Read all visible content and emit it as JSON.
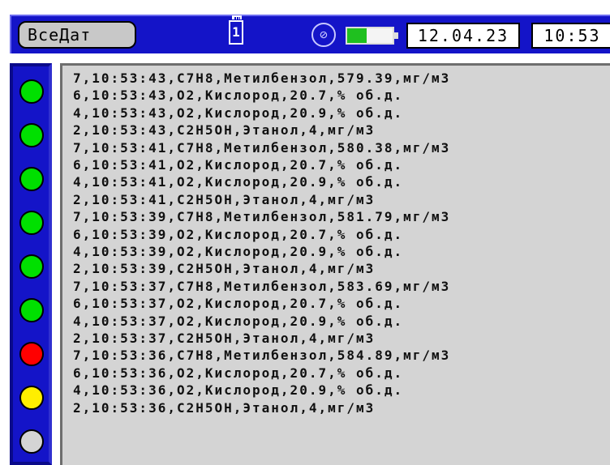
{
  "topbar": {
    "all_button_label": "ВсеДат",
    "sd_card_label": "1",
    "mute_icon": "⊘",
    "battery_level": 0.42,
    "date": "12.04.23",
    "time": "10:53"
  },
  "indicators": [
    {
      "color": "#00e000",
      "name": "green"
    },
    {
      "color": "#00e000",
      "name": "green"
    },
    {
      "color": "#00e000",
      "name": "green"
    },
    {
      "color": "#00e000",
      "name": "green"
    },
    {
      "color": "#00e000",
      "name": "green"
    },
    {
      "color": "#00e000",
      "name": "green"
    },
    {
      "color": "#ff0000",
      "name": "red"
    },
    {
      "color": "#ffee00",
      "name": "yellow"
    },
    {
      "color": "#d4d4d4",
      "name": "gray"
    }
  ],
  "log": [
    "7,10:53:43,C7H8,Метилбензол,579.39,мг/м3",
    "6,10:53:43,O2,Кислород,20.7,% об.д.",
    "4,10:53:43,O2,Кислород,20.9,% об.д.",
    "2,10:53:43,C2H5OH,Этанол,4,мг/м3",
    "7,10:53:41,C7H8,Метилбензол,580.38,мг/м3",
    "6,10:53:41,O2,Кислород,20.7,% об.д.",
    "4,10:53:41,O2,Кислород,20.9,% об.д.",
    "2,10:53:41,C2H5OH,Этанол,4,мг/м3",
    "7,10:53:39,C7H8,Метилбензол,581.79,мг/м3",
    "6,10:53:39,O2,Кислород,20.7,% об.д.",
    "4,10:53:39,O2,Кислород,20.9,% об.д.",
    "2,10:53:39,C2H5OH,Этанол,4,мг/м3",
    "7,10:53:37,C7H8,Метилбензол,583.69,мг/м3",
    "6,10:53:37,O2,Кислород,20.7,% об.д.",
    "4,10:53:37,O2,Кислород,20.9,% об.д.",
    "2,10:53:37,C2H5OH,Этанол,4,мг/м3",
    "7,10:53:36,C7H8,Метилбензол,584.89,мг/м3",
    "6,10:53:36,O2,Кислород,20.7,% об.д.",
    "4,10:53:36,O2,Кислород,20.9,% об.д.",
    "2,10:53:36,C2H5OH,Этанол,4,мг/м3"
  ]
}
